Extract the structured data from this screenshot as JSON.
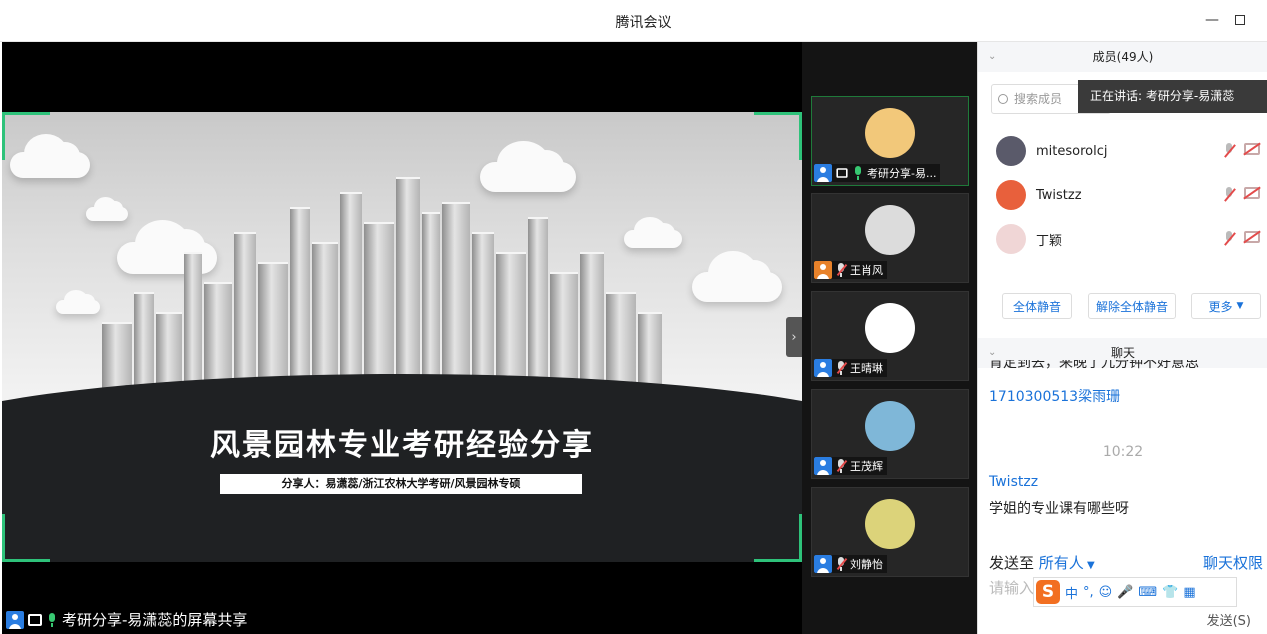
{
  "window": {
    "title": "腾讯会议",
    "minimize_icon": "minimize-icon",
    "maximize_icon": "maximize-icon"
  },
  "share": {
    "label": "考研分享-易潇蕊的屏幕共享",
    "slide_title": "风景园林专业考研经验分享",
    "slide_subtitle": "分享人：易潇蕊/浙江农林大学考研/风景园林专硕"
  },
  "videos": [
    {
      "name": "考研分享-易...",
      "mic": "on",
      "active": true,
      "avatar_color": "#f2c87a"
    },
    {
      "name": "王肖风",
      "mic": "off",
      "active": false,
      "avatar_color": "#dcdcdc"
    },
    {
      "name": "王晴琳",
      "mic": "off",
      "active": false,
      "avatar_color": "#ffffff"
    },
    {
      "name": "王茂辉",
      "mic": "off",
      "active": false,
      "avatar_color": "#7fb7d8"
    },
    {
      "name": "刘静怡",
      "mic": "off",
      "active": false,
      "avatar_color": "#dcd37a"
    }
  ],
  "members": {
    "header": "成员(49人)",
    "search_placeholder": "搜索成员",
    "speaking": "正在讲话: 考研分享-易潇蕊",
    "list": [
      {
        "name": "mitesorolcj",
        "avatar_color": "#5a5a6a"
      },
      {
        "name": "Twistzz",
        "avatar_color": "#e8603c"
      },
      {
        "name": "丁颖",
        "avatar_color": "#f0d6d6"
      }
    ],
    "mute_all": "全体静音",
    "unmute_all": "解除全体静音",
    "more": "更多"
  },
  "chat": {
    "header": "聊天",
    "partial_line": "肯定到去，来晚了九分钟不好意思",
    "msg1_name": "1710300513梁雨珊",
    "time": "10:22",
    "msg2_name": "Twistzz",
    "msg2_text": "学姐的专业课有哪些呀",
    "send_to_label": "发送至",
    "send_to_target": "所有人",
    "permissions": "聊天权限",
    "input_placeholder": "请输入",
    "send_button": "发送(S)",
    "ime_items": [
      "中",
      "°,",
      "☺",
      "🎤",
      "⌨",
      "👕",
      "▦"
    ]
  }
}
